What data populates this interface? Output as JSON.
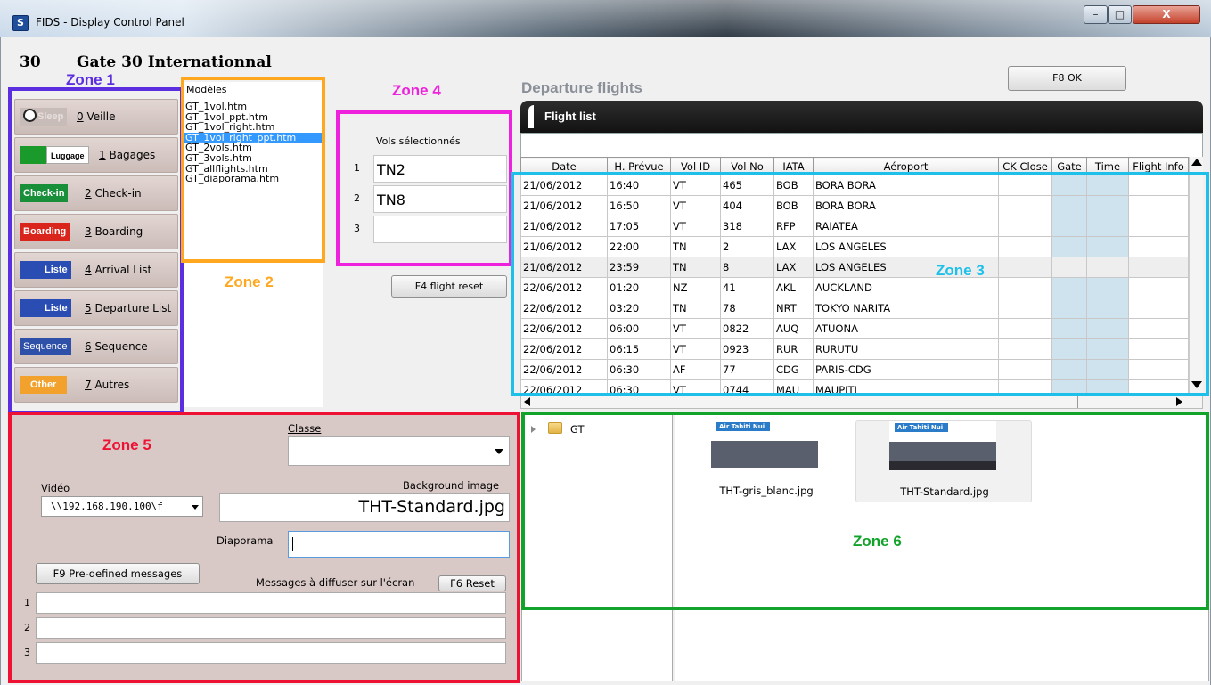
{
  "window": {
    "title": "FIDS - Display Control Panel",
    "close_glyph": "X",
    "min_glyph": "–",
    "max_glyph": "□"
  },
  "gate": {
    "number": "30",
    "name": "Gate 30 Internationnal"
  },
  "zones": {
    "z1": "Zone 1",
    "z2": "Zone 2",
    "z3": "Zone 3",
    "z4": "Zone 4",
    "z5": "Zone 5",
    "z6": "Zone 6",
    "colors": {
      "z1": "#5b2ee0",
      "z2": "#ffa81f",
      "z3": "#1ec0ea",
      "z4": "#ee22dd",
      "z5": "#ee1133",
      "z6": "#12a32a"
    }
  },
  "menu": [
    {
      "badge": "Sleep",
      "badge_color": "#c8bcb8",
      "key": "0",
      "label": "Veille",
      "icon": "sleep-icon"
    },
    {
      "badge": "Luggage",
      "badge_color": "#ffffff",
      "key": "1",
      "label": "Bagages",
      "icon": "luggage-icon"
    },
    {
      "badge": "Check-in",
      "badge_color": "#1a8f3a",
      "key": "2",
      "label": "Check-in",
      "icon": "checkin-icon"
    },
    {
      "badge": "Boarding",
      "badge_color": "#d9251c",
      "key": "3",
      "label": "Boarding",
      "icon": "boarding-icon"
    },
    {
      "badge": "Liste",
      "badge_color": "#2a4db3",
      "key": "4",
      "label": "Arrival List",
      "icon": "arrival-plane-icon"
    },
    {
      "badge": "Liste",
      "badge_color": "#2a4db3",
      "key": "5",
      "label": "Departure List",
      "icon": "departure-plane-icon"
    },
    {
      "badge": "Sequence",
      "badge_color": "#2f50a8",
      "key": "6",
      "label": "Sequence",
      "icon": "sequence-icon"
    },
    {
      "badge": "Other",
      "badge_color": "#f2a12c",
      "key": "7",
      "label": "Autres",
      "icon": "other-icon"
    }
  ],
  "modeles": {
    "title": "Modèles",
    "items": [
      "GT_1vol.htm",
      "GT_1vol_ppt.htm",
      "GT_1vol_right.htm",
      "GT_1vol_right_ppt.htm",
      "GT_2vols.htm",
      "GT_3vols.htm",
      "GT_allflights.htm",
      "GT_diaporama.htm"
    ],
    "selected_index": 3
  },
  "vols": {
    "title": "Vols sélectionnés",
    "rows": [
      {
        "num": "1",
        "value": "TN2"
      },
      {
        "num": "2",
        "value": "TN8"
      },
      {
        "num": "3",
        "value": ""
      }
    ],
    "reset_button": "F4 flight reset"
  },
  "ok_button": "F8 OK",
  "departure": {
    "title": "Departure flights",
    "list_title": "Flight list",
    "columns": [
      "Date",
      "H. Prévue",
      "Vol ID",
      "Vol No",
      "IATA",
      "Aéroport",
      "CK Close",
      "Gate",
      "Time",
      "Flight Info"
    ],
    "rows": [
      [
        "21/06/2012",
        "16:40",
        "VT",
        "465",
        "BOB",
        "BORA BORA"
      ],
      [
        "21/06/2012",
        "16:50",
        "VT",
        "404",
        "BOB",
        "BORA BORA"
      ],
      [
        "21/06/2012",
        "17:05",
        "VT",
        "318",
        "RFP",
        "RAIATEA"
      ],
      [
        "21/06/2012",
        "22:00",
        "TN",
        "2",
        "LAX",
        "LOS ANGELES"
      ],
      [
        "21/06/2012",
        "23:59",
        "TN",
        "8",
        "LAX",
        "LOS ANGELES"
      ],
      [
        "22/06/2012",
        "01:20",
        "NZ",
        "41",
        "AKL",
        "AUCKLAND"
      ],
      [
        "22/06/2012",
        "03:20",
        "TN",
        "78",
        "NRT",
        "TOKYO NARITA"
      ],
      [
        "22/06/2012",
        "06:00",
        "VT",
        "0822",
        "AUQ",
        "ATUONA"
      ],
      [
        "22/06/2012",
        "06:15",
        "VT",
        "0923",
        "RUR",
        "RURUTU"
      ],
      [
        "22/06/2012",
        "06:30",
        "AF",
        "77",
        "CDG",
        "PARIS-CDG"
      ],
      [
        "22/06/2012",
        "06:30",
        "VT",
        "0744",
        "MAU",
        "MAUPITI"
      ]
    ],
    "highlight_row": 4
  },
  "form": {
    "classe_label": "Classe",
    "video_label": "Vidéo",
    "video_value": "\\\\192.168.190.100\\f",
    "bg_label": "Background image",
    "bg_value": "THT-Standard.jpg",
    "diaporama_label": "Diaporama",
    "f9_button": "F9  Pre-defined messages",
    "messages_label": "Messages à diffuser sur l'écran",
    "f6_button": "F6 Reset",
    "msg_nums": [
      "1",
      "2",
      "3"
    ]
  },
  "files": {
    "folder": "GT",
    "thumbs": [
      {
        "name": "THT-gris_blanc.jpg",
        "logo": "Air Tahiti Nui"
      },
      {
        "name": "THT-Standard.jpg",
        "logo": "Air Tahiti Nui"
      }
    ]
  }
}
